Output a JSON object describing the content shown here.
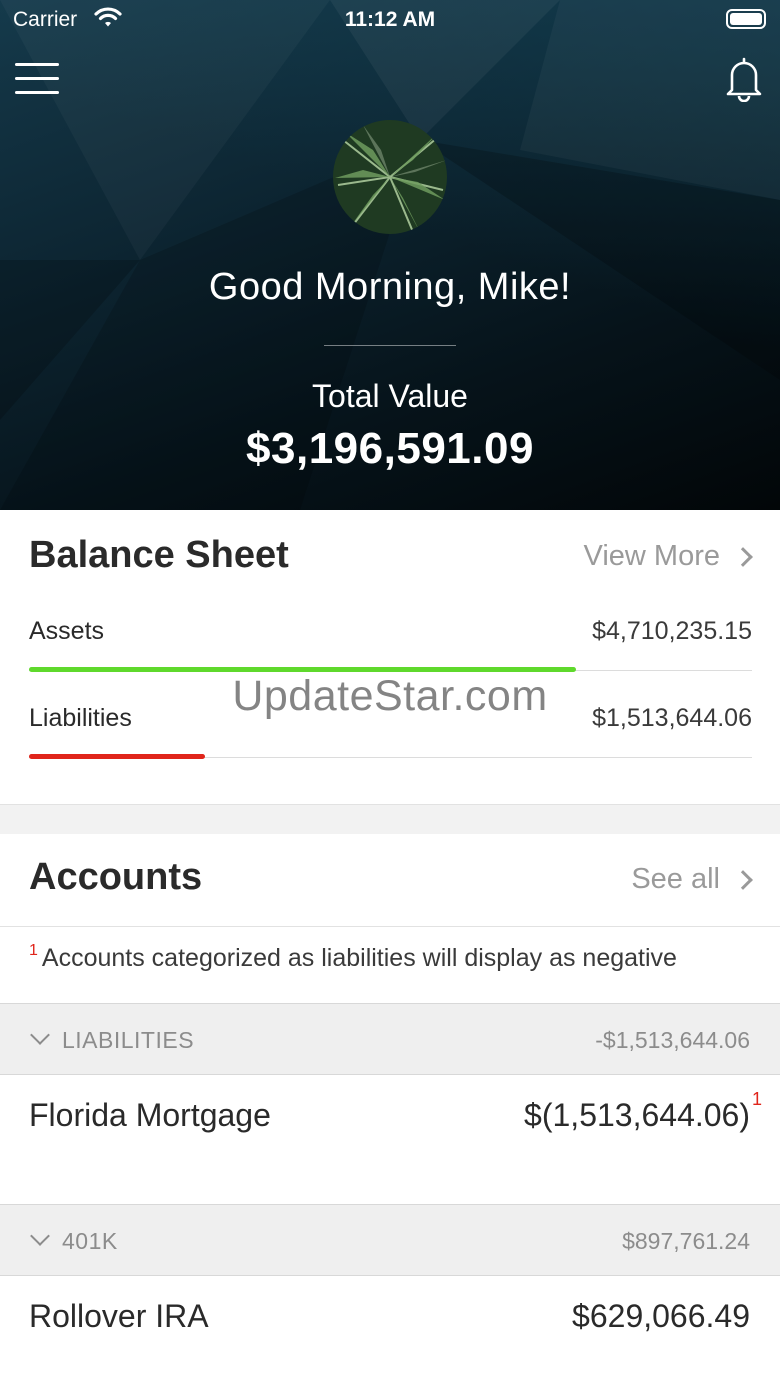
{
  "status_bar": {
    "carrier": "Carrier",
    "time": "11:12 AM"
  },
  "header": {
    "greeting": "Good Morning, Mike!",
    "total_label": "Total Value",
    "total_value": "$3,196,591.09"
  },
  "balance_sheet": {
    "title": "Balance Sheet",
    "link_label": "View More",
    "rows": [
      {
        "label": "Assets",
        "value": "$4,710,235.15",
        "fill_fraction": 0.757,
        "color": "#5fd92c"
      },
      {
        "label": "Liabilities",
        "value": "$1,513,644.06",
        "fill_fraction": 0.243,
        "color": "#e0251b"
      }
    ]
  },
  "watermark": "UpdateStar.com",
  "accounts": {
    "title": "Accounts",
    "link_label": "See all",
    "note_marker": "1",
    "note": "Accounts categorized as liabilities will display as negative",
    "groups": [
      {
        "name": "LIABILITIES",
        "total": "-$1,513,644.06",
        "accounts": [
          {
            "name": "Florida Mortgage",
            "value": "$(1,513,644.06)",
            "marker": "1"
          }
        ]
      },
      {
        "name": "401K",
        "total": "$897,761.24",
        "accounts": [
          {
            "name": "Rollover IRA",
            "value": "$629,066.49"
          }
        ]
      }
    ]
  },
  "colors": {
    "hero_bg": "#0d2633",
    "asset_bar": "#5fd92c",
    "liability_bar": "#e0251b",
    "muted_text": "#9a9a9a"
  },
  "icons": [
    "wifi-icon",
    "battery-icon",
    "menu-icon",
    "bell-icon",
    "chevron-right-icon",
    "chevron-down-icon"
  ]
}
